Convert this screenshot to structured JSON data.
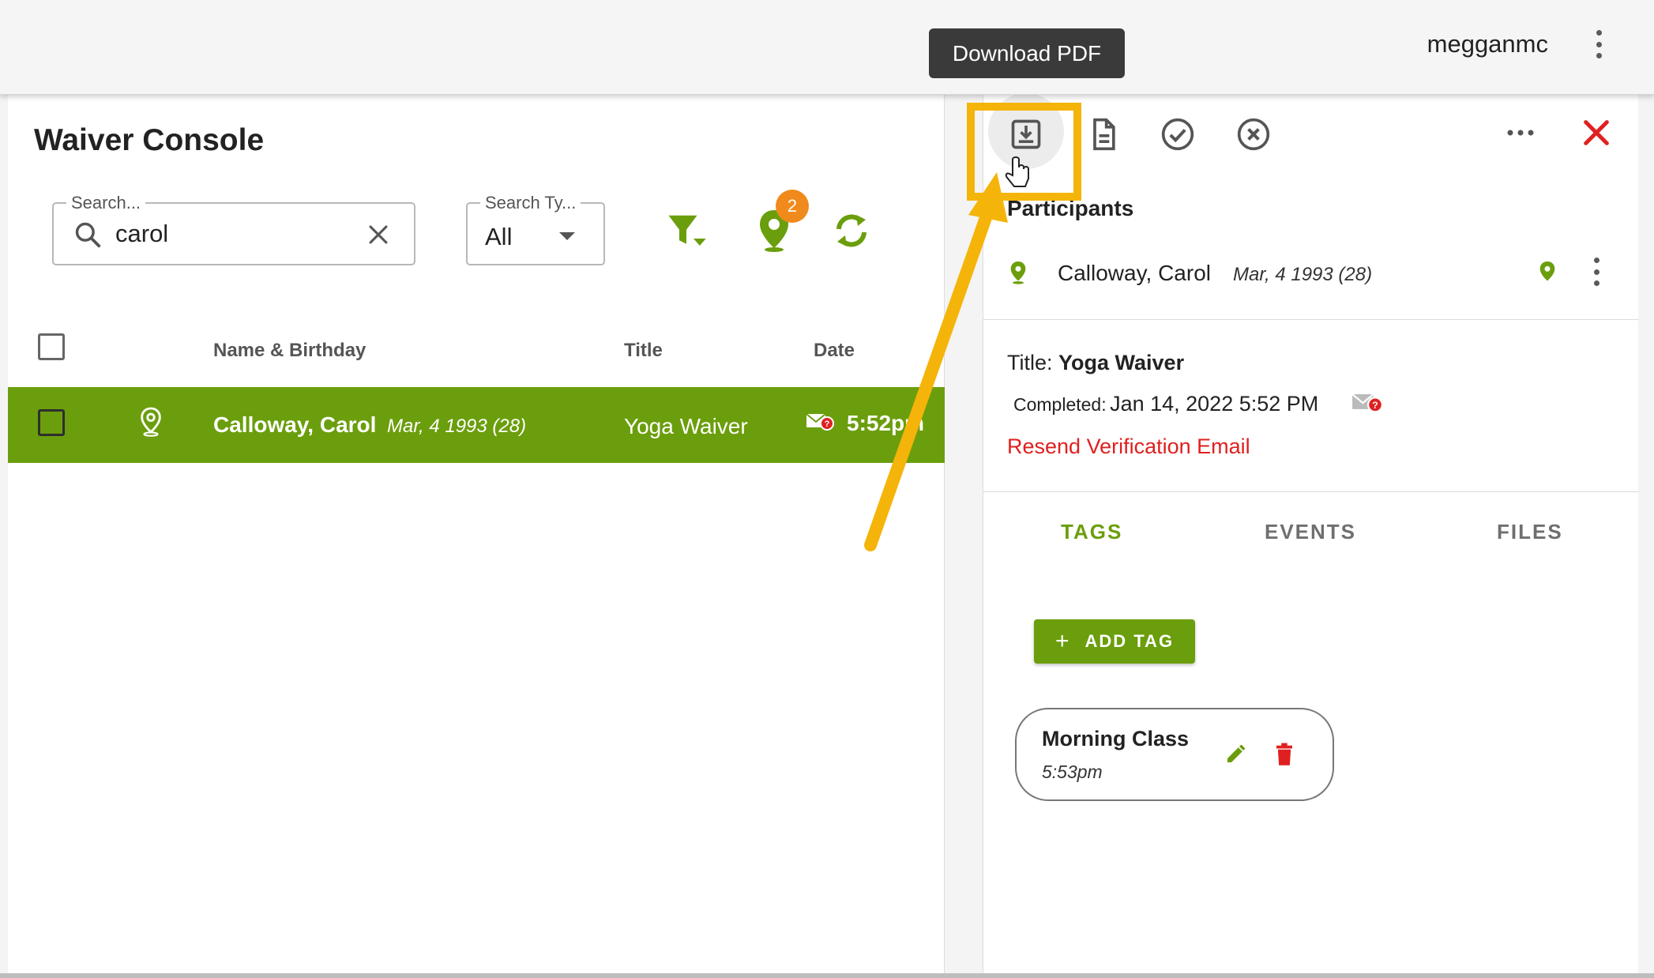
{
  "header": {
    "username": "megganmc",
    "tooltip": "Download PDF"
  },
  "console": {
    "title": "Waiver Console",
    "search": {
      "legend": "Search...",
      "value": "carol"
    },
    "search_type": {
      "legend": "Search Ty...",
      "value": "All"
    },
    "location_badge_count": "2",
    "columns": {
      "name": "Name & Birthday",
      "title": "Title",
      "date": "Date"
    },
    "rows": [
      {
        "name": "Calloway, Carol",
        "birthday": "Mar, 4 1993 (28)",
        "title": "Yoga Waiver",
        "date": "5:52pm"
      }
    ]
  },
  "detail": {
    "participants_heading": "Participants",
    "participant": {
      "name": "Calloway, Carol",
      "birthday": "Mar, 4 1993 (28)"
    },
    "title_label": "Title:",
    "title_value": "Yoga Waiver",
    "completed_label": "Completed:",
    "completed_value": "Jan 14, 2022 5:52 PM",
    "resend_link": "Resend Verification Email",
    "tabs": [
      "TAGS",
      "EVENTS",
      "FILES"
    ],
    "add_tag_label": "ADD TAG",
    "tag": {
      "name": "Morning Class",
      "time": "5:53pm"
    }
  },
  "colors": {
    "brand_green": "#6b9e0c",
    "danger_red": "#e02020",
    "badge_orange": "#f08a1c",
    "highlight_yellow": "#f5b40a"
  }
}
